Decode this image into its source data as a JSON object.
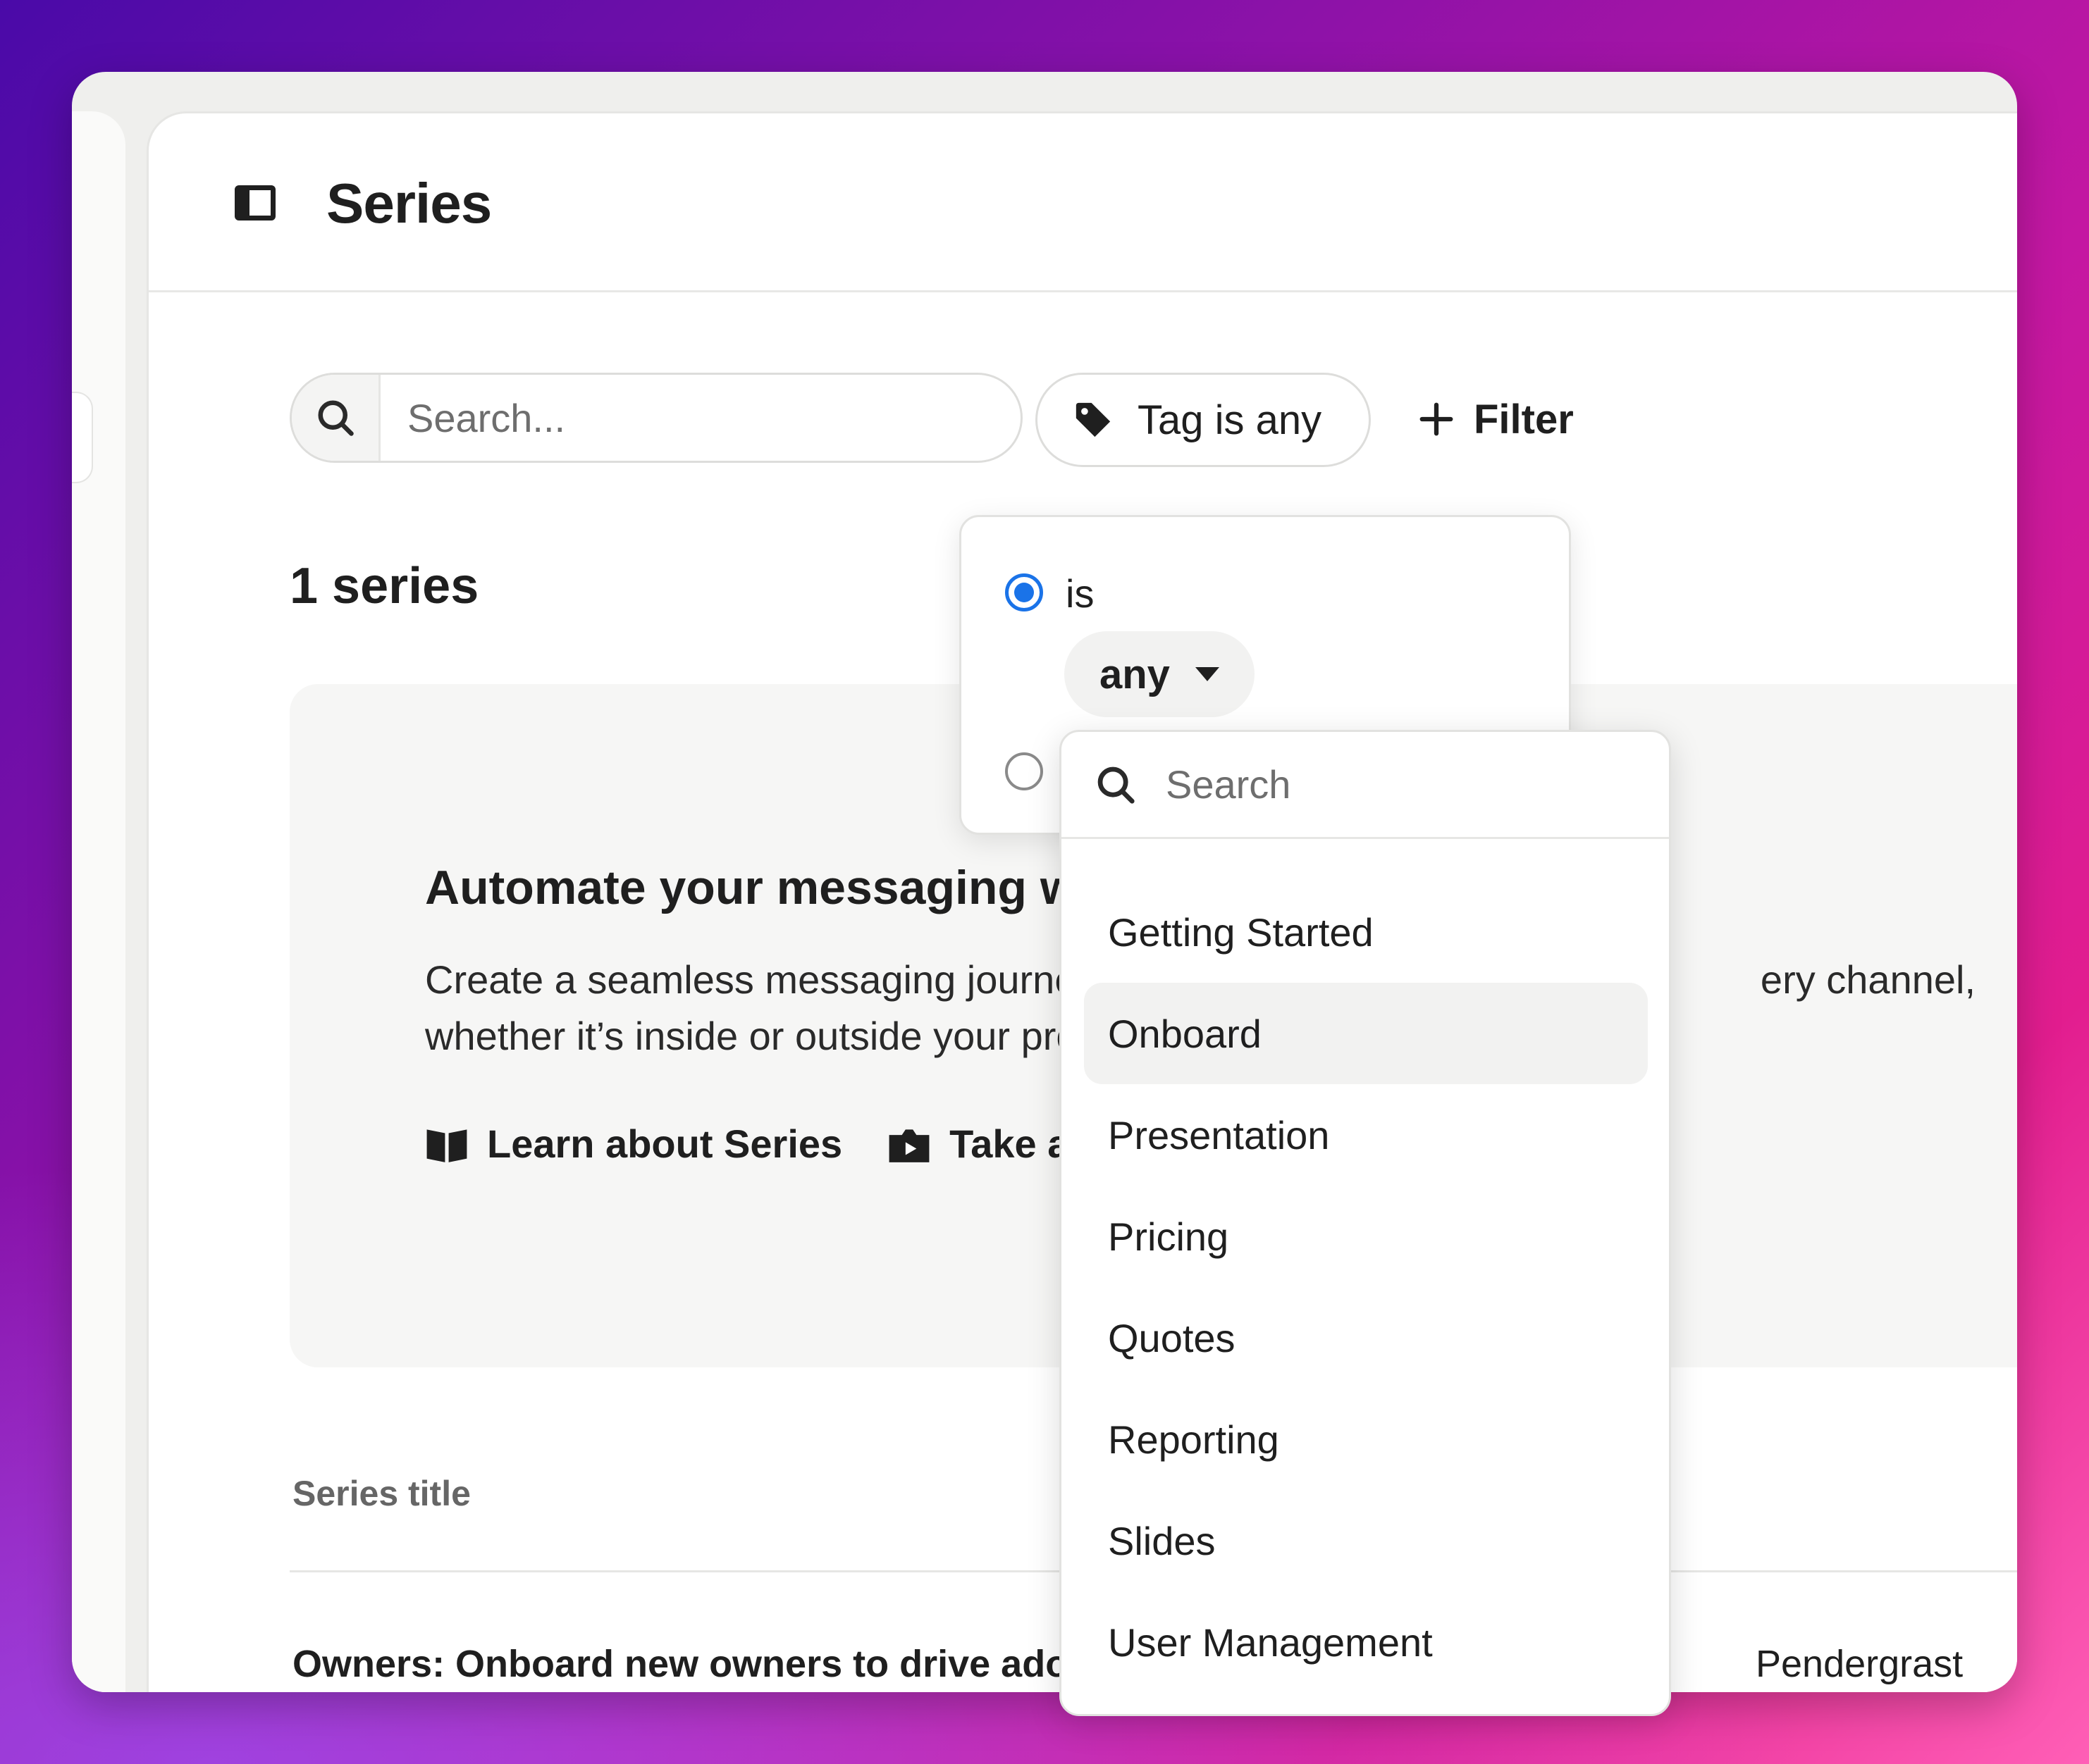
{
  "header": {
    "title": "Series"
  },
  "toolbar": {
    "search_placeholder": "Search...",
    "tag_filter_label": "Tag is any",
    "add_filter_label": "Filter"
  },
  "summary": {
    "count_label": "1 series"
  },
  "promo": {
    "title": "Automate your messaging wi",
    "description_line1": "Create a seamless messaging journey",
    "description_line1_end": "ery channel,",
    "description_line2": "whether it’s inside or outside your proc",
    "links": [
      {
        "label": "Learn about Series",
        "icon": "book-icon"
      },
      {
        "label": "Take a to",
        "icon": "video-icon"
      }
    ]
  },
  "table": {
    "columns": [
      "Series title"
    ],
    "rows": [
      {
        "title": "Owners: Onboard new owners to drive ado...",
        "owner": "Pendergrast"
      }
    ]
  },
  "tag_popover": {
    "operator_is_label": "is",
    "operator_is_selected": true,
    "value_select": "any"
  },
  "tag_dropdown": {
    "search_placeholder": "Search",
    "options": [
      "Getting Started",
      "Onboard",
      "Presentation",
      "Pricing",
      "Quotes",
      "Reporting",
      "Slides",
      "User Management"
    ],
    "highlighted": "Onboard"
  },
  "colors": {
    "accent_blue": "#1a73e8",
    "text_primary": "#1f1f1f",
    "muted_text": "#666666",
    "panel_bg": "#ffffff",
    "promo_bg": "#f6f6f5"
  }
}
